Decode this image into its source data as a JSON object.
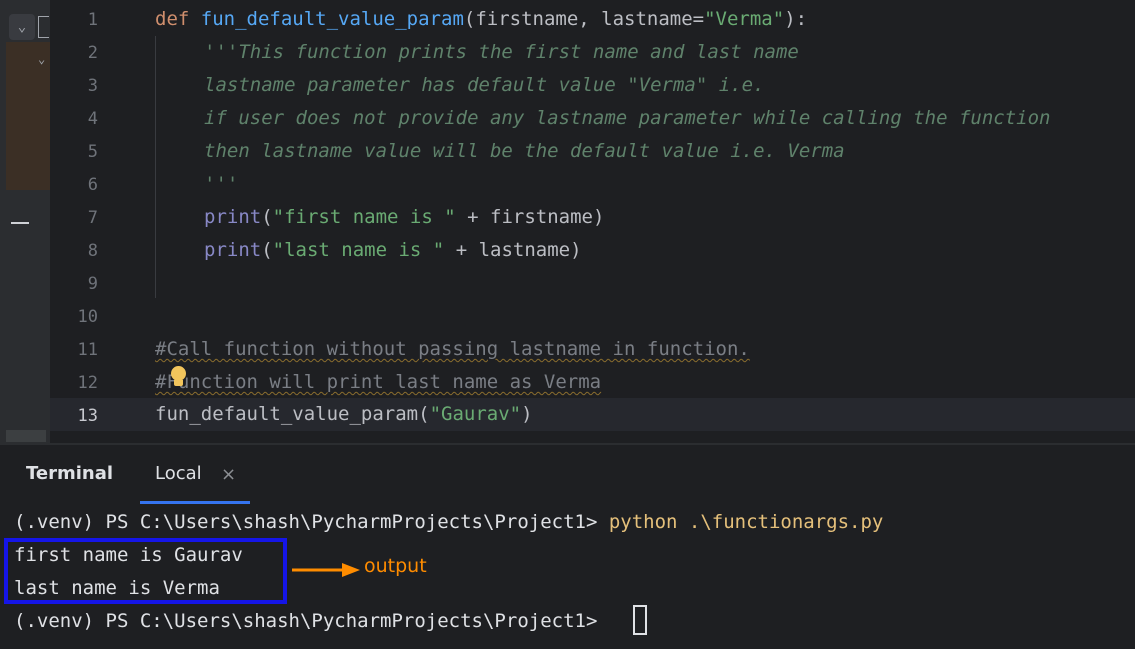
{
  "editor": {
    "line_numbers": [
      "1",
      "2",
      "3",
      "4",
      "5",
      "6",
      "7",
      "8",
      "9",
      "10",
      "11",
      "12",
      "13"
    ],
    "code": {
      "l1": {
        "kw": "def",
        "fn": "fun_default_value_param",
        "a": "(firstname, lastname=",
        "s": "\"Verma\"",
        "b": "):"
      },
      "l2": "'''This function prints the first name and last name",
      "l3": "lastname parameter has default value \"Verma\" i.e.",
      "l4": "if user does not provide any lastname parameter while calling the function",
      "l5": "then lastname value will be the default value i.e. Verma",
      "l6": "'''",
      "l7": {
        "fn": "print",
        "a": "(",
        "s": "\"first name is \"",
        "b": " + firstname)"
      },
      "l8": {
        "fn": "print",
        "a": "(",
        "s": "\"last name is \"",
        "b": " + lastname)"
      },
      "l11": "#Call function without passing lastname in function.",
      "l12": "#Function will print last name as Verma",
      "l13": {
        "fn": "fun_default_value_param",
        "a": "(",
        "s": "\"Gaurav\"",
        "b": ")"
      }
    }
  },
  "terminal": {
    "title": "Terminal",
    "tab": "Local",
    "close": "×",
    "prompt1": "(.venv) PS C:\\Users\\shash\\PycharmProjects\\Project1> ",
    "command": "python .\\functionargs.py",
    "out1": "first name is Gaurav",
    "out2": "last name is Verma",
    "prompt2": "(.venv) PS C:\\Users\\shash\\PycharmProjects\\Project1> ",
    "annotation": "output"
  },
  "colors": {
    "accent": "#3574f0",
    "annotation": "#ff8c00",
    "box": "#1515e8"
  }
}
